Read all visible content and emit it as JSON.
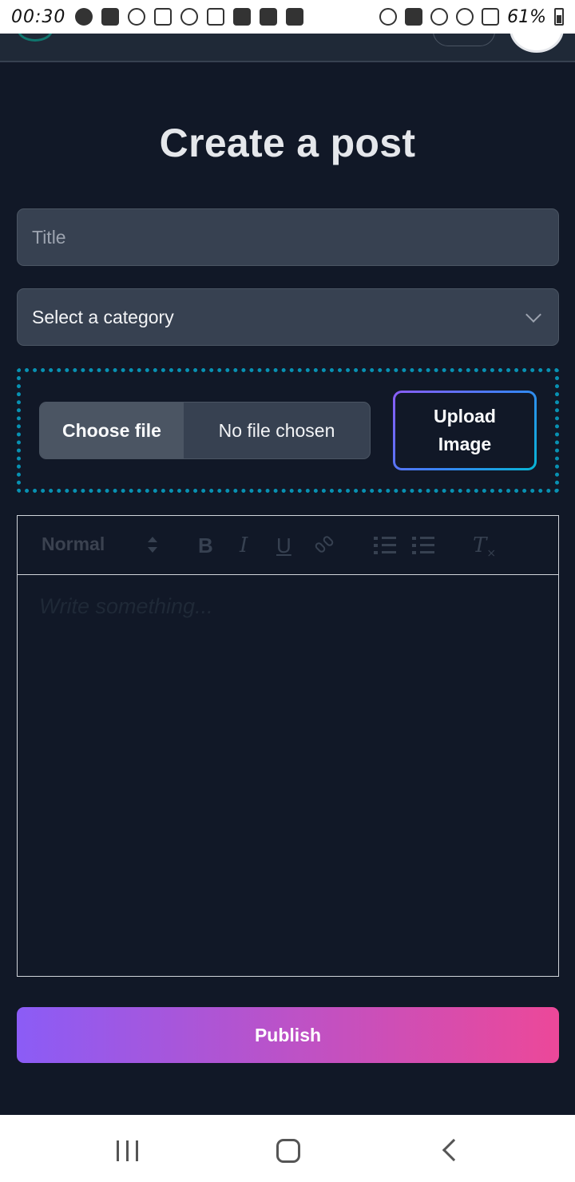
{
  "status_bar": {
    "time": "00:30",
    "battery": "61%"
  },
  "page": {
    "title": "Create a post"
  },
  "form": {
    "title_placeholder": "Title",
    "category_selected": "Select a category",
    "choose_file_label": "Choose file",
    "file_status": "No file chosen",
    "upload_label": "Upload Image",
    "publish_label": "Publish"
  },
  "editor": {
    "format_value": "Normal",
    "bold_label": "B",
    "italic_label": "I",
    "underline_label": "U",
    "clean_label": "T",
    "placeholder": "Write something..."
  },
  "colors": {
    "background": "#111827",
    "field_bg": "#374151",
    "dropzone_border": "#0891b2",
    "publish_gradient_start": "#8b5cf6",
    "publish_gradient_end": "#ec4899"
  }
}
